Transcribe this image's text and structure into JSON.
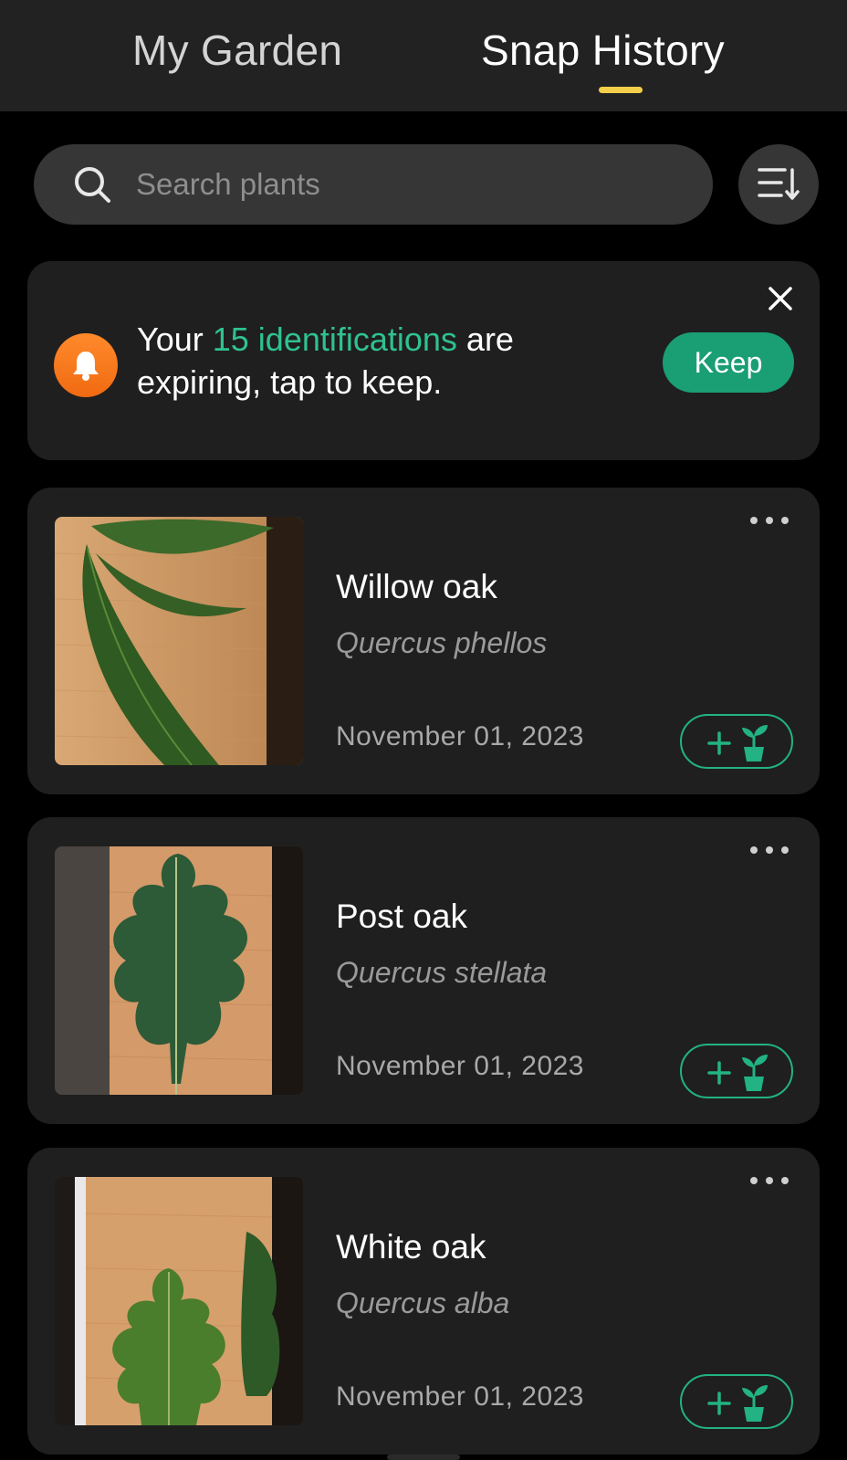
{
  "tabs": [
    {
      "label": "My Garden",
      "active": false
    },
    {
      "label": "Snap History",
      "active": true
    }
  ],
  "search": {
    "placeholder": "Search plants",
    "value": ""
  },
  "banner": {
    "text_prefix": "Your ",
    "highlight": "15 identifications",
    "text_suffix": " are expiring, tap to keep.",
    "keep_label": "Keep",
    "icon": "bell-icon"
  },
  "cards": [
    {
      "name": "Willow oak",
      "scientific": "Quercus phellos",
      "date": "November 01, 2023"
    },
    {
      "name": "Post oak",
      "scientific": "Quercus stellata",
      "date": "November 01, 2023"
    },
    {
      "name": "White oak",
      "scientific": "Quercus alba",
      "date": "November 01, 2023"
    }
  ],
  "colors": {
    "accent_green": "#22b283",
    "highlight_green": "#2fc28f",
    "keep_button": "#1a9e74",
    "tab_indicator": "#f4cf4b",
    "bell_orange": "#f07a1e",
    "card_bg": "#1f1f1f",
    "header_bg": "#222222"
  }
}
